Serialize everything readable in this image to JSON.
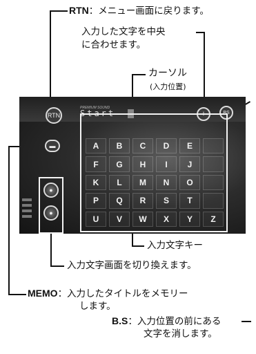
{
  "screen": {
    "header_small": "PREMIUM SOUND",
    "title_text": "Start",
    "rtn_button": "RTN",
    "bs_button": "BS",
    "keys": [
      "A",
      "B",
      "C",
      "D",
      "E",
      "",
      "F",
      "G",
      "H",
      "I",
      "J",
      "",
      "K",
      "L",
      "M",
      "N",
      "O",
      "",
      "P",
      "Q",
      "R",
      "S",
      "T",
      "",
      "U",
      "V",
      "W",
      "X",
      "Y",
      "Z"
    ]
  },
  "annotations": {
    "rtn": {
      "key": "RTN",
      "desc": "：メニュー画面に戻ります。"
    },
    "center": {
      "line1": "入力した文字を中央",
      "line2": "に合わせます。"
    },
    "cursor": {
      "line1": "カーソル",
      "line2": "(入力位置)"
    },
    "keys": "入力文字キー",
    "switch": "入力文字画面を切り換えます。",
    "memo": {
      "key": "MEMO",
      "desc": "：入力したタイトルをメモリー",
      "line2": "します。"
    },
    "bs": {
      "key": "B.S",
      "desc": "：入力位置の前にある",
      "line2": "文字を消します。"
    }
  }
}
